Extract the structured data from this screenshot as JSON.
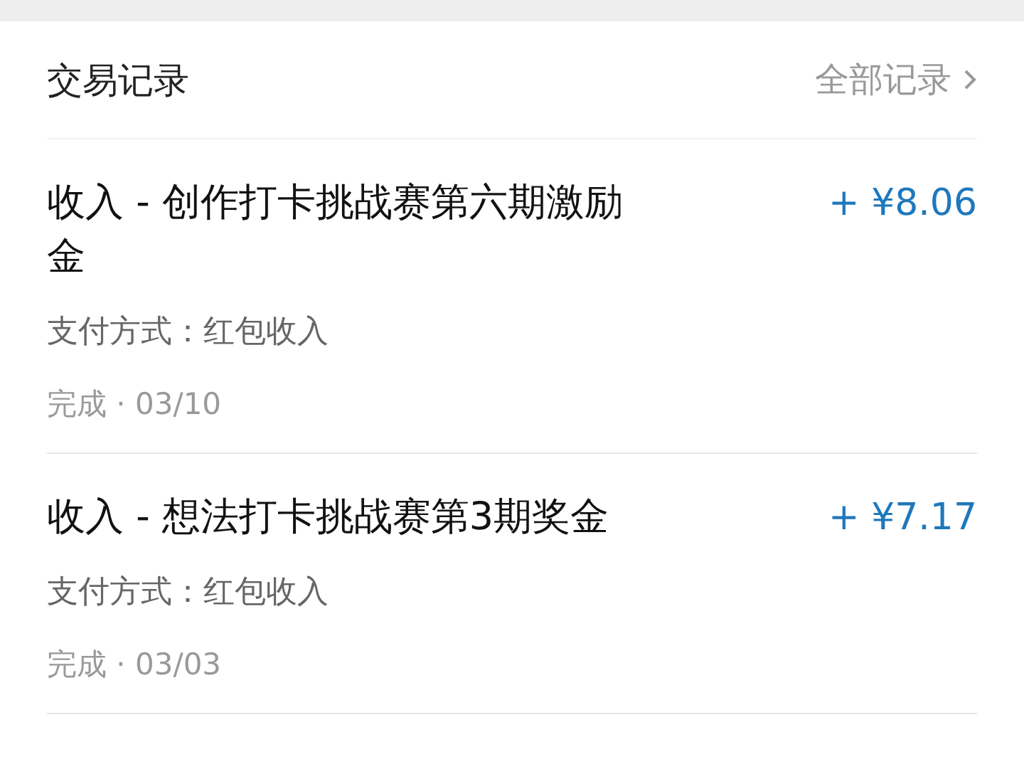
{
  "header": {
    "title": "交易记录",
    "link": "全部记录"
  },
  "transactions": [
    {
      "title": "收入 - 创作打卡挑战赛第六期激励金",
      "amount": "+ ¥8.06",
      "method": "支付方式：红包收入",
      "status": "完成 · 03/10"
    },
    {
      "title": "收入 - 想法打卡挑战赛第3期奖金",
      "amount": "+ ¥7.17",
      "method": "支付方式：红包收入",
      "status": "完成 · 03/03"
    }
  ]
}
